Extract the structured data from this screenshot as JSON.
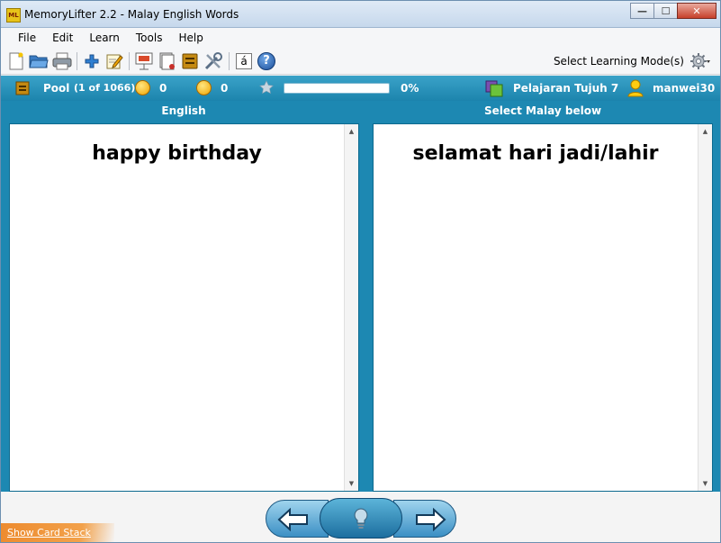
{
  "window": {
    "title": "MemoryLifter 2.2 - Malay English Words",
    "app_icon_text": "ML",
    "controls": {
      "minimize": "—",
      "maximize": "☐",
      "close": "✕"
    }
  },
  "menu": [
    "File",
    "Edit",
    "Learn",
    "Tools",
    "Help"
  ],
  "toolbar": {
    "icons": [
      "new-document-icon",
      "open-folder-icon",
      "print-icon",
      "add-card-icon",
      "edit-icon",
      "presentation-icon",
      "card-stack-icon",
      "dictionary-icon",
      "settings-tools-icon",
      "special-character-icon",
      "help-icon"
    ],
    "special_char": "á",
    "help_char": "?",
    "learning_mode_label": "Select Learning Mode(s)"
  },
  "stats": {
    "pool_label": "Pool",
    "pool_count": "(1 of 1066)",
    "correct_count": "0",
    "wrong_count": "0",
    "progress_percent": "0%",
    "progress_fraction": 0,
    "chapter": "Pelajaran Tujuh 7",
    "user": "manwei30"
  },
  "cards": {
    "left_header": "English",
    "right_header": "Select Malay below",
    "question": "happy birthday",
    "answer": "selamat hari jadi/lahir"
  },
  "footer": {
    "show_card_stack": "Show Card Stack"
  },
  "colors": {
    "accent": "#1d88b2",
    "stats_bar": "#2a94bd",
    "orange": "#ed8b2f"
  }
}
